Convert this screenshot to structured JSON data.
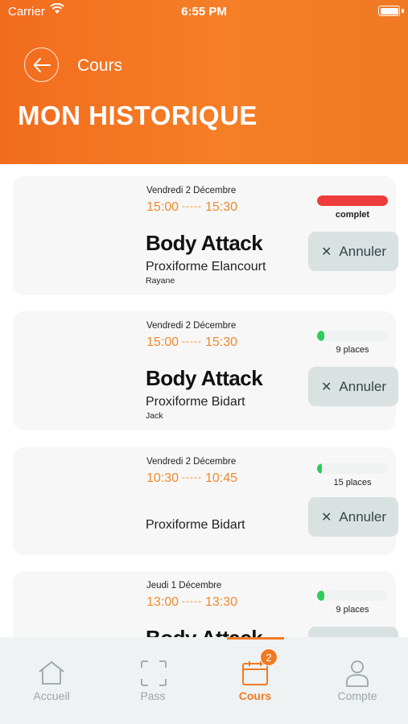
{
  "status_bar": {
    "carrier": "Carrier",
    "time": "6:55 PM"
  },
  "header": {
    "nav_title": "Cours",
    "page_title": "MON HISTORIQUE"
  },
  "colors": {
    "accent": "#f07a23",
    "full": "#ee3b3b",
    "available": "#2ecc5a"
  },
  "bookings": [
    {
      "date": "Vendredi 2 Décembre",
      "start": "15:00",
      "sep": "-----",
      "end": "15:30",
      "course": "Body Attack",
      "club": "Proxiforme Elancourt",
      "coach": "Rayane",
      "capacity_label": "complet",
      "fill_fraction": 1.0,
      "full": true,
      "cancel_label": "Annuler"
    },
    {
      "date": "Vendredi 2 Décembre",
      "start": "15:00",
      "sep": "-----",
      "end": "15:30",
      "course": "Body Attack",
      "club": "Proxiforme Bidart",
      "coach": "Jack",
      "capacity_label": "9  places",
      "fill_fraction": 0.1,
      "full": false,
      "cancel_label": "Annuler"
    },
    {
      "date": "Vendredi 2 Décembre",
      "start": "10:30",
      "sep": "-----",
      "end": "10:45",
      "course": "",
      "club": "Proxiforme Bidart",
      "coach": "",
      "capacity_label": "15  places",
      "fill_fraction": 0.07,
      "full": false,
      "cancel_label": "Annuler"
    },
    {
      "date": "Jeudi 1 Décembre",
      "start": "13:00",
      "sep": "-----",
      "end": "13:30",
      "course": "Body Attack",
      "club": "",
      "coach": "",
      "capacity_label": "9  places",
      "fill_fraction": 0.1,
      "full": false,
      "cancel_label": ""
    }
  ],
  "tabbar": {
    "tabs": [
      {
        "label": "Accueil",
        "icon": "home-icon",
        "active": false
      },
      {
        "label": "Pass",
        "icon": "scan-icon",
        "active": false
      },
      {
        "label": "Cours",
        "icon": "calendar-icon",
        "active": true,
        "badge": "2"
      },
      {
        "label": "Compte",
        "icon": "user-icon",
        "active": false
      }
    ]
  }
}
